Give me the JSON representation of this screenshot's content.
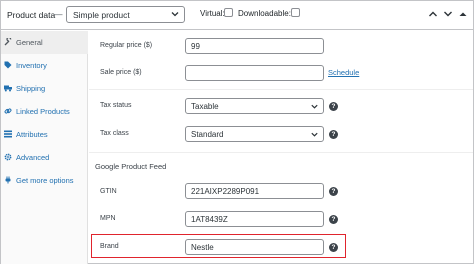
{
  "header": {
    "title": "Product data",
    "separator": "—",
    "product_type": "Simple product",
    "virtual_label": "Virtual:",
    "downloadable_label": "Downloadable:"
  },
  "sidebar": {
    "items": [
      {
        "label": "General",
        "icon": "wrench-icon",
        "active": true
      },
      {
        "label": "Inventory",
        "icon": "tag-icon",
        "active": false
      },
      {
        "label": "Shipping",
        "icon": "truck-icon",
        "active": false
      },
      {
        "label": "Linked Products",
        "icon": "link-icon",
        "active": false
      },
      {
        "label": "Attributes",
        "icon": "list-icon",
        "active": false
      },
      {
        "label": "Advanced",
        "icon": "gear-icon",
        "active": false
      },
      {
        "label": "Get more options",
        "icon": "plugin-icon",
        "active": false
      }
    ]
  },
  "general": {
    "regular_price_label": "Regular price ($)",
    "regular_price_value": "99",
    "sale_price_label": "Sale price ($)",
    "sale_price_value": "",
    "schedule_link": "Schedule",
    "tax_status_label": "Tax status",
    "tax_status_value": "Taxable",
    "tax_class_label": "Tax class",
    "tax_class_value": "Standard"
  },
  "feed": {
    "section_title": "Google Product Feed",
    "gtin_label": "GTIN",
    "gtin_value": "221AIXP2289P091",
    "mpn_label": "MPN",
    "mpn_value": "1AT8439Z",
    "brand_label": "Brand",
    "brand_value": "Nestle"
  },
  "colors": {
    "link": "#2271b1",
    "highlight": "#e0242d",
    "help_icon": "#3c434a"
  }
}
